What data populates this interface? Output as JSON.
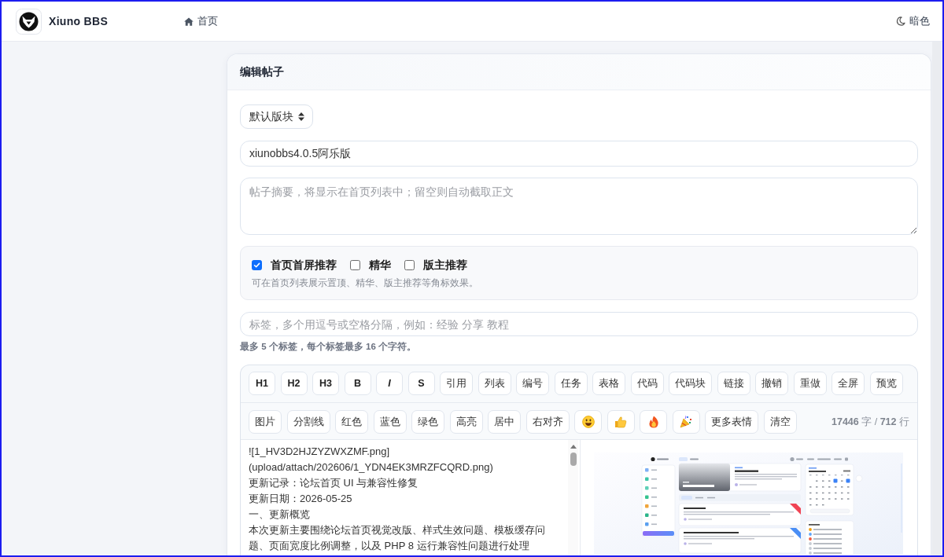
{
  "header": {
    "brand": "Xiuno BBS",
    "home_link": "首页",
    "theme_toggle": "暗色"
  },
  "card": {
    "title": "编辑帖子",
    "forum_select": {
      "value": "默认版块"
    },
    "title_field": {
      "value": "xiunobbs4.0.5阿乐版"
    },
    "summary_field": {
      "placeholder": "帖子摘要，将显示在首页列表中；留空则自动截取正文"
    },
    "options": {
      "checkboxes": [
        {
          "label": "首页首屏推荐",
          "checked": true
        },
        {
          "label": "精华",
          "checked": false
        },
        {
          "label": "版主推荐",
          "checked": false
        }
      ],
      "help": "可在首页列表展示置顶、精华、版主推荐等角标效果。"
    },
    "tags_field": {
      "placeholder": "标签，多个用逗号或空格分隔，例如：经验 分享 教程",
      "hint": "最多 5 个标签，每个标签最多 16 个字符。"
    },
    "editor": {
      "toolbar_rows": [
        [
          {
            "label": "H1",
            "kind": "mark"
          },
          {
            "label": "H2",
            "kind": "mark"
          },
          {
            "label": "H3",
            "kind": "mark"
          },
          {
            "label": "B",
            "kind": "mark"
          },
          {
            "label": "I",
            "kind": "italic"
          },
          {
            "label": "S",
            "kind": "mark"
          },
          {
            "label": "引用",
            "kind": "text"
          },
          {
            "label": "列表",
            "kind": "text"
          },
          {
            "label": "编号",
            "kind": "text"
          },
          {
            "label": "任务",
            "kind": "text"
          },
          {
            "label": "表格",
            "kind": "text"
          },
          {
            "label": "代码",
            "kind": "text"
          },
          {
            "label": "代码块",
            "kind": "text"
          },
          {
            "label": "链接",
            "kind": "text"
          },
          {
            "label": "撤销",
            "kind": "text"
          },
          {
            "label": "重做",
            "kind": "text"
          },
          {
            "label": "全屏",
            "kind": "text"
          },
          {
            "label": "预览",
            "kind": "text"
          }
        ],
        [
          {
            "label": "图片",
            "kind": "text"
          },
          {
            "label": "分割线",
            "kind": "text"
          },
          {
            "label": "红色",
            "kind": "text"
          },
          {
            "label": "蓝色",
            "kind": "text"
          },
          {
            "label": "绿色",
            "kind": "text"
          },
          {
            "label": "高亮",
            "kind": "text"
          },
          {
            "label": "居中",
            "kind": "text"
          },
          {
            "label": "右对齐",
            "kind": "text"
          },
          {
            "kind": "smile"
          },
          {
            "kind": "thumbs"
          },
          {
            "kind": "flame"
          },
          {
            "kind": "popper"
          },
          {
            "label": "更多表情",
            "kind": "text"
          },
          {
            "label": "清空",
            "kind": "text"
          }
        ]
      ],
      "counter": "**17446** 字 / **712** 行",
      "lines": [
        "![1_HV3D2HJZYZWXZMF.png]",
        "(upload/attach/202606/1_YDN4EK3MRZFCQRD.png)",
        "更新记录：论坛首页 UI 与兼容性修复",
        "更新日期：2026-05-25",
        "一、更新概览",
        "本次更新主要围绕论坛首页视觉改版、样式生效问题、模板缓存问",
        "题、页面宽度比例调整，以及 PHP 8 运行兼容性问题进行处理"
      ]
    }
  }
}
